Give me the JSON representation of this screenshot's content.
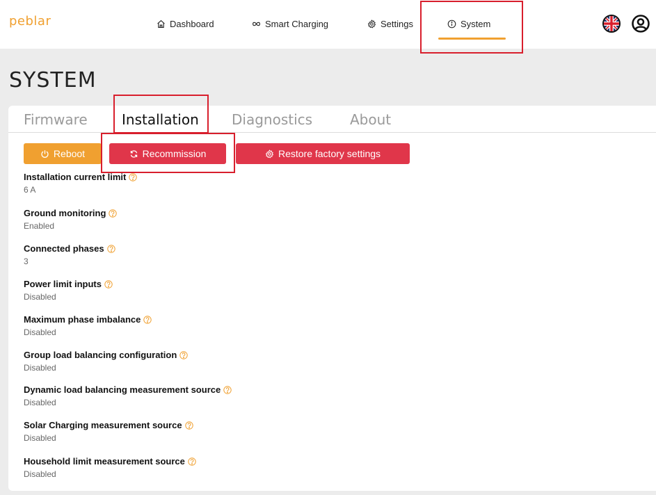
{
  "app": {
    "logo": "peblar"
  },
  "nav": {
    "items": [
      {
        "label": "Dashboard",
        "icon": "home-icon"
      },
      {
        "label": "Smart Charging",
        "icon": "infinity-icon"
      },
      {
        "label": "Settings",
        "icon": "gear-icon"
      },
      {
        "label": "System",
        "icon": "info-icon",
        "active": true
      }
    ],
    "language_icon": "uk-flag-icon",
    "user_icon": "user-circle-icon"
  },
  "page": {
    "title": "SYSTEM"
  },
  "tabs": [
    {
      "label": "Firmware",
      "active": false
    },
    {
      "label": "Installation",
      "active": true
    },
    {
      "label": "Diagnostics",
      "active": false
    },
    {
      "label": "About",
      "active": false
    }
  ],
  "actions": [
    {
      "label": "Reboot",
      "icon": "power-icon",
      "color": "#f0a030"
    },
    {
      "label": "Recommission",
      "icon": "refresh-icon",
      "color": "#e0364a"
    },
    {
      "label": "Restore factory settings",
      "icon": "gear-icon",
      "color": "#e0364a"
    }
  ],
  "settings": [
    {
      "label": "Installation current limit",
      "value": "6 A"
    },
    {
      "label": "Ground monitoring",
      "value": "Enabled"
    },
    {
      "label": "Connected phases",
      "value": "3"
    },
    {
      "label": "Power limit inputs",
      "value": "Disabled"
    },
    {
      "label": "Maximum phase imbalance",
      "value": "Disabled"
    },
    {
      "label": "Group load balancing configuration",
      "value": "Disabled"
    },
    {
      "label": "Dynamic load balancing measurement source",
      "value": "Disabled"
    },
    {
      "label": "Solar Charging measurement source",
      "value": "Disabled"
    },
    {
      "label": "Household limit measurement source",
      "value": "Disabled"
    }
  ],
  "colors": {
    "accent": "#f0a030",
    "danger": "#e0364a",
    "highlight": "#d81e2c"
  }
}
